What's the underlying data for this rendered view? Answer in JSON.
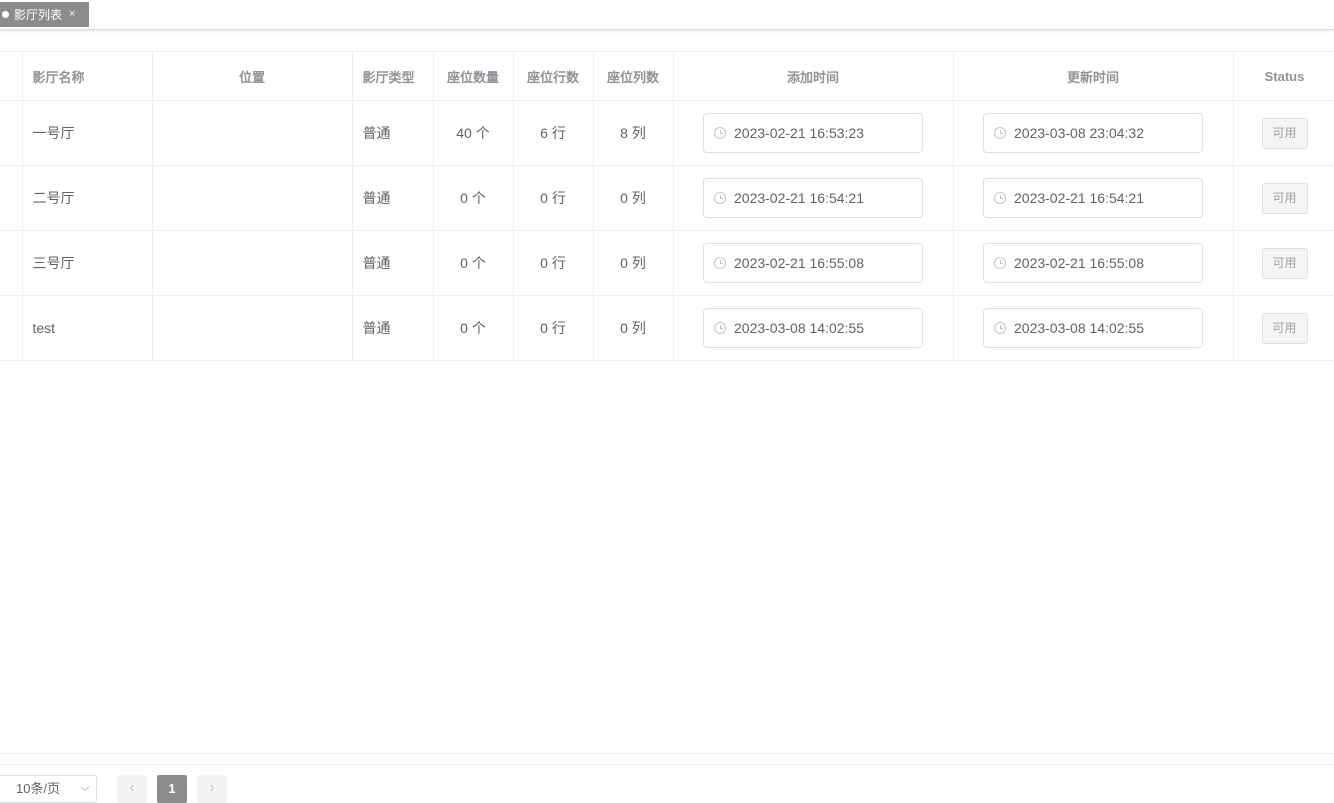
{
  "tabs": [
    {
      "label": "影厅列表",
      "close": "×"
    }
  ],
  "table": {
    "headers": [
      "影厅名称",
      "位置",
      "影厅类型",
      "座位数量",
      "座位行数",
      "座位列数",
      "添加时间",
      "更新时间",
      "Status"
    ],
    "rows": [
      {
        "name": "一号厅",
        "location": "",
        "type": "普通",
        "seats": "40 个",
        "rows": "6 行",
        "cols": "8 列",
        "added": "2023-02-21 16:53:23",
        "updated": "2023-03-08 23:04:32",
        "status": "可用"
      },
      {
        "name": "二号厅",
        "location": "",
        "type": "普通",
        "seats": "0 个",
        "rows": "0 行",
        "cols": "0 列",
        "added": "2023-02-21 16:54:21",
        "updated": "2023-02-21 16:54:21",
        "status": "可用"
      },
      {
        "name": "三号厅",
        "location": "",
        "type": "普通",
        "seats": "0 个",
        "rows": "0 行",
        "cols": "0 列",
        "added": "2023-02-21 16:55:08",
        "updated": "2023-02-21 16:55:08",
        "status": "可用"
      },
      {
        "name": "test",
        "location": "",
        "type": "普通",
        "seats": "0 个",
        "rows": "0 行",
        "cols": "0 列",
        "added": "2023-03-08 14:02:55",
        "updated": "2023-03-08 14:02:55",
        "status": "可用"
      }
    ]
  },
  "pagination": {
    "page_size": "10条/页",
    "prev": "‹",
    "current_page": "1",
    "next": "›"
  },
  "colors": {
    "active_tab_bg": "#8c8c8c",
    "border": "#ebeef5",
    "header_text": "#909399"
  }
}
